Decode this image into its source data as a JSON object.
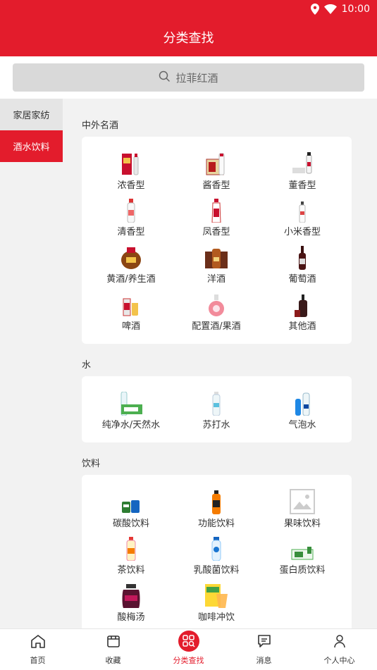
{
  "status_bar": {
    "time": "10:00"
  },
  "header": {
    "title": "分类查找"
  },
  "search": {
    "placeholder": "拉菲红酒"
  },
  "sidebar": {
    "items": [
      {
        "label": "家居家纺",
        "active": false
      },
      {
        "label": "酒水饮料",
        "active": true
      }
    ]
  },
  "sections": [
    {
      "title": "中外名酒",
      "items": [
        {
          "label": "浓香型",
          "icon": "baijiu-box-icon"
        },
        {
          "label": "酱香型",
          "icon": "moutai-box-icon"
        },
        {
          "label": "董香型",
          "icon": "baijiu-bottle-icon"
        },
        {
          "label": "清香型",
          "icon": "baijiu-bottle-icon"
        },
        {
          "label": "凤香型",
          "icon": "baijiu-bottle-icon"
        },
        {
          "label": "小米香型",
          "icon": "baijiu-bottle-icon"
        },
        {
          "label": "黄酒/养生酒",
          "icon": "yellow-wine-jar-icon"
        },
        {
          "label": "洋酒",
          "icon": "cognac-icon"
        },
        {
          "label": "葡萄酒",
          "icon": "red-wine-bottle-icon"
        },
        {
          "label": "啤酒",
          "icon": "beer-icon"
        },
        {
          "label": "配置酒/果酒",
          "icon": "fruit-wine-icon"
        },
        {
          "label": "其他酒",
          "icon": "liquor-icon"
        }
      ]
    },
    {
      "title": "水",
      "items": [
        {
          "label": "纯净水/天然水",
          "icon": "water-pack-icon"
        },
        {
          "label": "苏打水",
          "icon": "soda-water-icon"
        },
        {
          "label": "气泡水",
          "icon": "sparkling-water-icon"
        }
      ]
    },
    {
      "title": "饮料",
      "items": [
        {
          "label": "碳酸饮料",
          "icon": "soda-cans-icon"
        },
        {
          "label": "功能饮料",
          "icon": "energy-drink-icon"
        },
        {
          "label": "果味饮料",
          "icon": "image-placeholder-icon"
        },
        {
          "label": "茶饮料",
          "icon": "tea-drink-icon"
        },
        {
          "label": "乳酸菌饮料",
          "icon": "yogurt-drink-icon"
        },
        {
          "label": "蛋白质饮料",
          "icon": "protein-drink-box-icon"
        },
        {
          "label": "酸梅汤",
          "icon": "plum-juice-jar-icon"
        },
        {
          "label": "咖啡冲饮",
          "icon": "coffee-drink-icon"
        }
      ]
    }
  ],
  "bottom_nav": [
    {
      "label": "首页",
      "icon": "home-icon",
      "active": false
    },
    {
      "label": "收藏",
      "icon": "favorite-store-icon",
      "active": false
    },
    {
      "label": "分类查找",
      "icon": "category-search-icon",
      "active": true
    },
    {
      "label": "消息",
      "icon": "message-icon",
      "active": false
    },
    {
      "label": "个人中心",
      "icon": "person-icon",
      "active": false
    }
  ],
  "colors": {
    "primary": "#e31c2c",
    "background": "#f2f2f2"
  }
}
